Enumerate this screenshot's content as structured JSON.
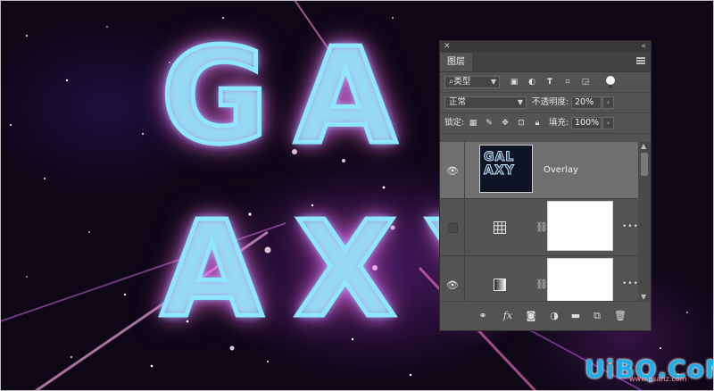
{
  "canvas": {
    "letters_row1": [
      "G",
      "A"
    ],
    "letters_row2": [
      "A",
      "X",
      "Y"
    ]
  },
  "panel": {
    "tab_label": "图层",
    "filter": {
      "value": "类型"
    },
    "blend": {
      "value": "正常",
      "opacity_label": "不透明度:",
      "opacity_value": "20%"
    },
    "lock": {
      "label": "锁定:",
      "fill_label": "填充:",
      "fill_value": "100%"
    },
    "layers": [
      {
        "name": "Overlay",
        "thumb_text": "GAL AXY",
        "selected": true,
        "visible": true,
        "type": "smart-object"
      },
      {
        "name": "",
        "selected": false,
        "visible": false,
        "type": "grid-adjustment",
        "has_mask": true
      },
      {
        "name": "",
        "selected": false,
        "visible": true,
        "type": "gradient-adjustment",
        "has_mask": true
      }
    ],
    "footer_icons": [
      "link-icon",
      "fx-icon",
      "mask-icon",
      "adjustment-icon",
      "folder-icon",
      "new-layer-icon",
      "trash-icon"
    ]
  },
  "watermark": {
    "text": "UiBQ.CoM",
    "sub": "www.psahz.com"
  }
}
